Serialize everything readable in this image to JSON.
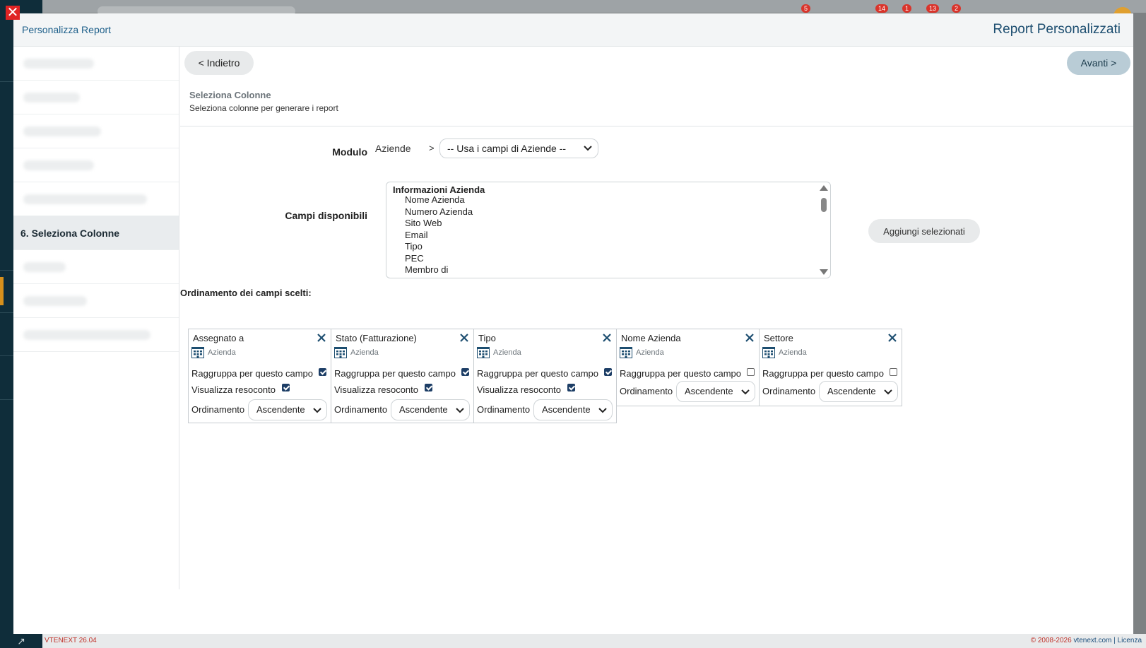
{
  "background": {
    "badges": [
      "5",
      "14",
      "1",
      "13",
      "2"
    ],
    "footer_left": "VTENEXT 26.04",
    "footer_right_copy": "© 2008-2026 ",
    "footer_right_link": "vtenext.com",
    "footer_right_sep": " | ",
    "footer_right_license": "Licenza",
    "bottom_icon": "collapse-icon"
  },
  "modal": {
    "breadcrumb": "Personalizza Report",
    "title": "Report Personalizzati",
    "close_icon": "close-icon"
  },
  "left_nav": {
    "active_label": "6. Seleziona Colonne"
  },
  "toolbar": {
    "back_label": "< Indietro",
    "next_label": "Avanti >"
  },
  "step": {
    "title": "Seleziona Colonne",
    "subtitle": "Seleziona colonne per generare i report"
  },
  "form": {
    "module_label": "Modulo",
    "module_name": "Aziende",
    "module_sep": ">",
    "module_select_value": "-- Usa i campi di Aziende --",
    "fields_label": "Campi disponibili",
    "fields_group": "Informazioni Azienda",
    "fields_options": [
      "Nome Azienda",
      "Numero Azienda",
      "Sito Web",
      "Email",
      "Tipo",
      "PEC",
      "Membro di"
    ],
    "add_button": "Aggiungi selezionati"
  },
  "ordering": {
    "title": "Ordinamento dei campi scelti:",
    "group_label": "Raggruppa per questo campo",
    "summary_label": "Visualizza resoconto",
    "order_label": "Ordinamento",
    "cards": [
      {
        "name": "Assegnato a",
        "module": "Azienda",
        "group_checked": true,
        "summary_checked": true,
        "show_summary": true,
        "order": "Ascendente"
      },
      {
        "name": "Stato (Fatturazione)",
        "module": "Azienda",
        "group_checked": true,
        "summary_checked": true,
        "show_summary": true,
        "order": "Ascendente"
      },
      {
        "name": "Tipo",
        "module": "Azienda",
        "group_checked": true,
        "summary_checked": true,
        "show_summary": true,
        "order": "Ascendente"
      },
      {
        "name": "Nome Azienda",
        "module": "Azienda",
        "group_checked": false,
        "summary_checked": false,
        "show_summary": false,
        "order": "Ascendente"
      },
      {
        "name": "Settore",
        "module": "Azienda",
        "group_checked": false,
        "summary_checked": false,
        "show_summary": false,
        "order": "Ascendente"
      }
    ]
  },
  "colors": {
    "accent": "#1d4e70",
    "checkbox": "#1d3e66",
    "close": "#e02424"
  }
}
